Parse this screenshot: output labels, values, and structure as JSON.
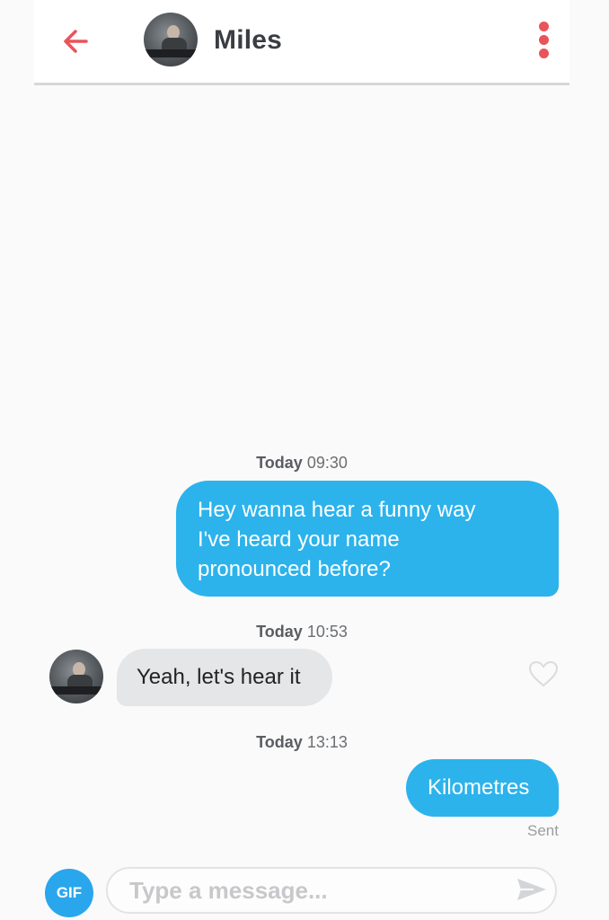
{
  "header": {
    "contact_name": "Miles",
    "back_icon": "arrow-left-icon",
    "menu_icon": "kebab-menu-icon",
    "accent_color": "#e9545b"
  },
  "messages": [
    {
      "timestamp_day": "Today",
      "timestamp_time": "09:30"
    },
    {
      "direction": "outgoing",
      "lines": [
        "Hey wanna hear a funny way",
        "I've heard your name",
        "pronounced before?"
      ]
    },
    {
      "timestamp_day": "Today",
      "timestamp_time": "10:53"
    },
    {
      "direction": "incoming",
      "text": "Yeah, let's hear it"
    },
    {
      "timestamp_day": "Today",
      "timestamp_time": "13:13"
    },
    {
      "direction": "outgoing",
      "text": "Kilometres",
      "status": "Sent"
    }
  ],
  "composer": {
    "gif_label": "GIF",
    "placeholder": "Type a message...",
    "send_icon": "send-icon"
  },
  "colors": {
    "outgoing_bubble": "#2cb3ec",
    "incoming_bubble": "#e5e6e8",
    "gif_button": "#2aa6ec"
  }
}
